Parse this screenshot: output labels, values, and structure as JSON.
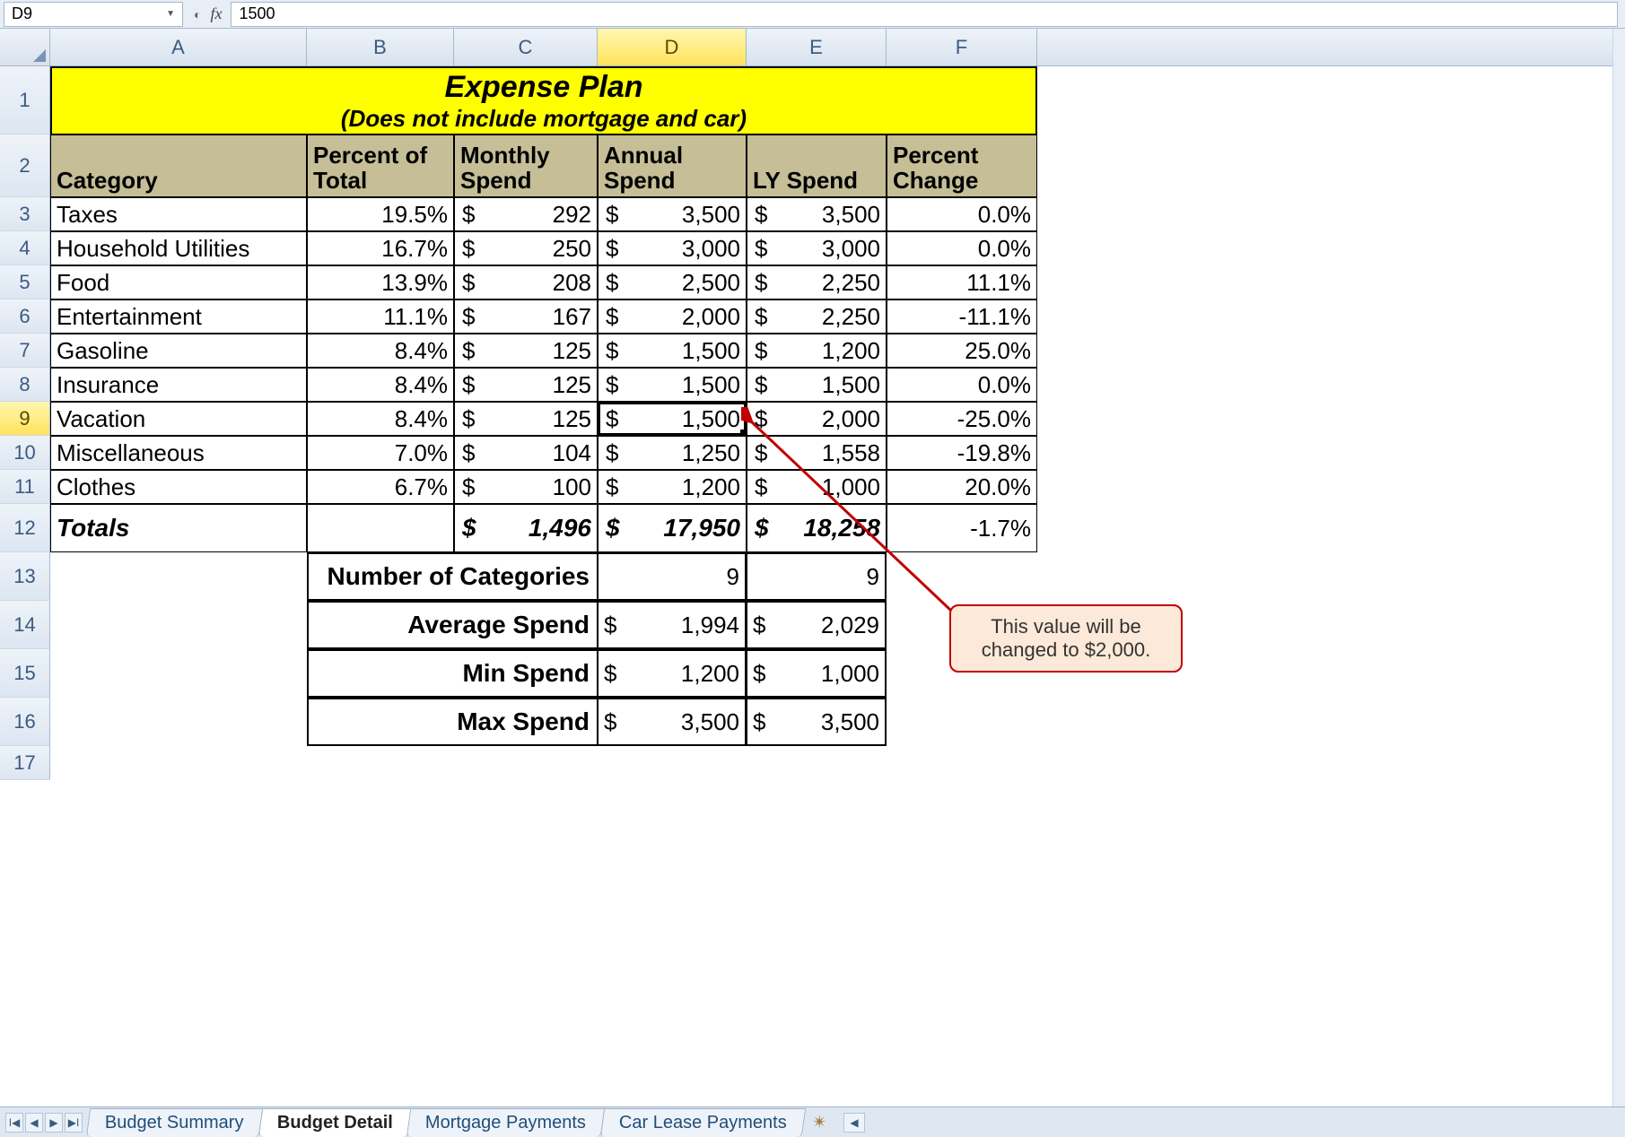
{
  "formula_bar": {
    "name_box": "D9",
    "fx_label": "fx",
    "formula_value": "1500"
  },
  "columns": [
    "A",
    "B",
    "C",
    "D",
    "E",
    "F"
  ],
  "active_column": "D",
  "row_numbers": [
    1,
    2,
    3,
    4,
    5,
    6,
    7,
    8,
    9,
    10,
    11,
    12,
    13,
    14,
    15,
    16,
    17
  ],
  "active_row": 9,
  "title": {
    "line1": "Expense Plan",
    "line2": "(Does not include mortgage and car)"
  },
  "headers": {
    "category": "Category",
    "percent_of_total": "Percent of Total",
    "monthly_spend": "Monthly Spend",
    "annual_spend": "Annual Spend",
    "ly_spend": "LY Spend",
    "percent_change": "Percent Change"
  },
  "rows": [
    {
      "category": "Taxes",
      "pct": "19.5%",
      "monthly": "292",
      "annual": "3,500",
      "ly": "3,500",
      "change": "0.0%"
    },
    {
      "category": "Household Utilities",
      "pct": "16.7%",
      "monthly": "250",
      "annual": "3,000",
      "ly": "3,000",
      "change": "0.0%"
    },
    {
      "category": "Food",
      "pct": "13.9%",
      "monthly": "208",
      "annual": "2,500",
      "ly": "2,250",
      "change": "11.1%"
    },
    {
      "category": "Entertainment",
      "pct": "11.1%",
      "monthly": "167",
      "annual": "2,000",
      "ly": "2,250",
      "change": "-11.1%"
    },
    {
      "category": "Gasoline",
      "pct": "8.4%",
      "monthly": "125",
      "annual": "1,500",
      "ly": "1,200",
      "change": "25.0%"
    },
    {
      "category": "Insurance",
      "pct": "8.4%",
      "monthly": "125",
      "annual": "1,500",
      "ly": "1,500",
      "change": "0.0%"
    },
    {
      "category": "Vacation",
      "pct": "8.4%",
      "monthly": "125",
      "annual": "1,500",
      "ly": "2,000",
      "change": "-25.0%"
    },
    {
      "category": "Miscellaneous",
      "pct": "7.0%",
      "monthly": "104",
      "annual": "1,250",
      "ly": "1,558",
      "change": "-19.8%"
    },
    {
      "category": "Clothes",
      "pct": "6.7%",
      "monthly": "100",
      "annual": "1,200",
      "ly": "1,000",
      "change": "20.0%"
    }
  ],
  "totals": {
    "label": "Totals",
    "monthly": "1,496",
    "annual": "17,950",
    "ly": "18,258",
    "change": "-1.7%"
  },
  "summary": [
    {
      "label": "Number of Categories",
      "d": "9",
      "e": "9",
      "money": false
    },
    {
      "label": "Average Spend",
      "d": "1,994",
      "e": "2,029",
      "money": true
    },
    {
      "label": "Min Spend",
      "d": "1,200",
      "e": "1,000",
      "money": true
    },
    {
      "label": "Max Spend",
      "d": "3,500",
      "e": "3,500",
      "money": true
    }
  ],
  "callout": {
    "line1": "This value will be",
    "line2": "changed to $2,000."
  },
  "sheet_tabs": {
    "tabs": [
      "Budget Summary",
      "Budget Detail",
      "Mortgage Payments",
      "Car Lease Payments"
    ],
    "active": "Budget Detail"
  },
  "currency_symbol": "$"
}
